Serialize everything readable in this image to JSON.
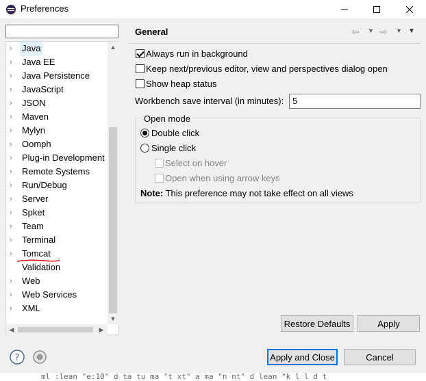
{
  "window": {
    "title": "Preferences",
    "minimize": "—",
    "maximize": "☐",
    "close": "✕"
  },
  "filter": {
    "value": "",
    "placeholder": ""
  },
  "tree": {
    "items": [
      {
        "label": "Java",
        "expandable": true,
        "selected": true
      },
      {
        "label": "Java EE",
        "expandable": true
      },
      {
        "label": "Java Persistence",
        "expandable": true
      },
      {
        "label": "JavaScript",
        "expandable": true
      },
      {
        "label": "JSON",
        "expandable": true
      },
      {
        "label": "Maven",
        "expandable": true
      },
      {
        "label": "Mylyn",
        "expandable": true
      },
      {
        "label": "Oomph",
        "expandable": true
      },
      {
        "label": "Plug-in Development",
        "expandable": true
      },
      {
        "label": "Remote Systems",
        "expandable": true
      },
      {
        "label": "Run/Debug",
        "expandable": true
      },
      {
        "label": "Server",
        "expandable": true
      },
      {
        "label": "Spket",
        "expandable": true
      },
      {
        "label": "Team",
        "expandable": true
      },
      {
        "label": "Terminal",
        "expandable": true
      },
      {
        "label": "Tomcat",
        "expandable": true,
        "underlined": true
      },
      {
        "label": "Validation",
        "expandable": false
      },
      {
        "label": "Web",
        "expandable": true
      },
      {
        "label": "Web Services",
        "expandable": true
      },
      {
        "label": "XML",
        "expandable": true
      }
    ]
  },
  "page": {
    "title": "General",
    "always_run_bg": {
      "label": "Always run in background",
      "checked": true
    },
    "keep_next_prev": {
      "label": "Keep next/previous editor, view and perspectives dialog open",
      "checked": false
    },
    "show_heap": {
      "label": "Show heap status",
      "checked": false
    },
    "save_interval": {
      "label": "Workbench save interval (in minutes):",
      "value": "5"
    },
    "open_mode": {
      "title": "Open mode",
      "double_click": "Double click",
      "single_click": "Single click",
      "select_on_hover": "Select on hover",
      "open_arrow_keys": "Open when using arrow keys",
      "selected": "double_click"
    },
    "note_label": "Note:",
    "note_text": " This preference may not take effect on all views",
    "restore_defaults": "Restore Defaults",
    "apply": "Apply"
  },
  "footer": {
    "apply_close": "Apply and Close",
    "cancel": "Cancel"
  },
  "colors": {
    "accent": "#0078d7",
    "underline": "#e00000"
  },
  "bottom_strip_text": "ml :lean  \"e:10\"  d  ta tu ma  \"t xt\"  a ma  \"n nt\"  d  lean  \"k  l  l  d  t"
}
